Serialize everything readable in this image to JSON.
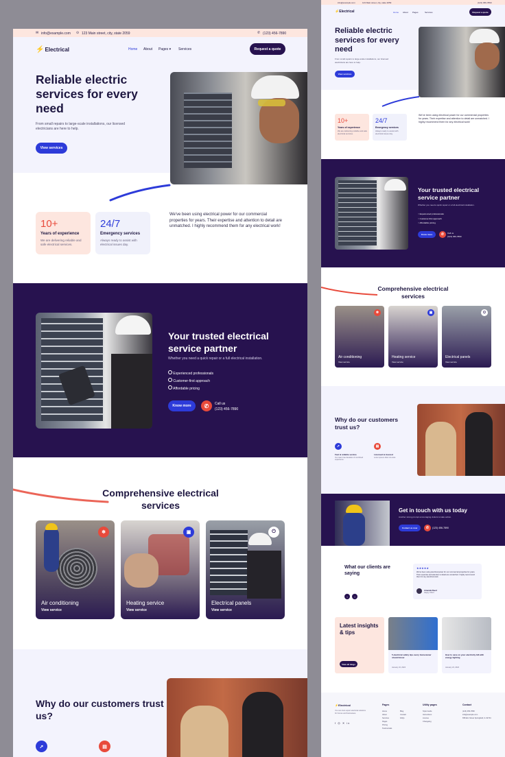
{
  "brand": "Electrical",
  "topbar": {
    "email": "info@example.com",
    "address": "123 Main street, city, state 2059",
    "phone": "(123) 456-7890"
  },
  "nav": {
    "home": "Home",
    "about": "About",
    "pages": "Pages",
    "services": "Services",
    "cta": "Request a quote"
  },
  "hero": {
    "title": "Reliable electric services for every need",
    "text": "From small repairs to large-scale installations, our licensed electricians are here to help.",
    "button": "View services"
  },
  "stats": [
    {
      "value": "10+",
      "label": "Years of experience",
      "desc": "We are delivering reliable and safe electrical services."
    },
    {
      "value": "24/7",
      "label": "Emergency services",
      "desc": "Always ready to assist with electrical issues day."
    }
  ],
  "testimonial_short": "We've been using electrical power for our commercial properties for years. Their expertise and attention to detail are unmatched. I highly recommend them for any electrical work!",
  "partner": {
    "title": "Your trusted electrical service partner",
    "text": "Whether you need a quick repair or a full electrical installation.",
    "bullets": [
      "Experienced professionals",
      "Customer-first approach",
      "Affordable pricing"
    ],
    "button": "Know more",
    "call_label": "Call us",
    "call_phone": "(123) 456-7890"
  },
  "services": {
    "title": "Comprehensive electrical services",
    "items": [
      {
        "name": "Air conditioning",
        "link": "View service"
      },
      {
        "name": "Heating service",
        "link": "View service"
      },
      {
        "name": "Electrical panels",
        "link": "View service"
      }
    ]
  },
  "trust": {
    "title": "Why do our customers trust us?",
    "features": [
      {
        "title": "Fast & reliable service",
        "desc": "Our team has decades of combined experience."
      },
      {
        "title": "Licensed & insured",
        "desc": "Lorem ipsum dolor sit amet."
      }
    ]
  },
  "contact": {
    "title": "Get in touch with us today",
    "text": "Another strong prompt encouraging visitors to take action.",
    "button": "Contact us now",
    "phone": "(123) 456-7890"
  },
  "clients": {
    "title": "What our clients are saying",
    "stars": "★★★★★",
    "quote": "We've been using electrical power for our commercial properties for years. Their expertise and attention to detail are unmatched. I highly recommend them for any electrical work.",
    "name": "Amanda Reed",
    "role": "Happy Client"
  },
  "insights": {
    "title": "Latest insights & tips",
    "button": "View all blogs",
    "posts": [
      {
        "title": "5 electrical safety tips every homeowner should know",
        "date": "January 24, 2024"
      },
      {
        "title": "How to save on your electricity bill with energy lighting",
        "date": "January 24, 2024"
      }
    ]
  },
  "footer": {
    "about": "You can trust expert electrical solutions for homes and businesses.",
    "pages_title": "Pages",
    "pages": [
      "Home",
      "About",
      "Services",
      "Pages",
      "Pricing",
      "Testimonials"
    ],
    "pages2": [
      "Blog",
      "Contact",
      "FAQs"
    ],
    "utility_title": "Utility pages",
    "utility": [
      "Style Guide",
      "Instructions",
      "License",
      "Changelog"
    ],
    "contact_title": "Contact",
    "contact": [
      "(123) 456-7890",
      "info@example.com",
      "658 Elm Street Springfield, IL 62704"
    ]
  },
  "colors": {
    "navy": "#27124f",
    "blue": "#2d3bd9",
    "accent": "#e84a3b",
    "peach": "#fde6df",
    "lavender": "#f3f3fd"
  }
}
